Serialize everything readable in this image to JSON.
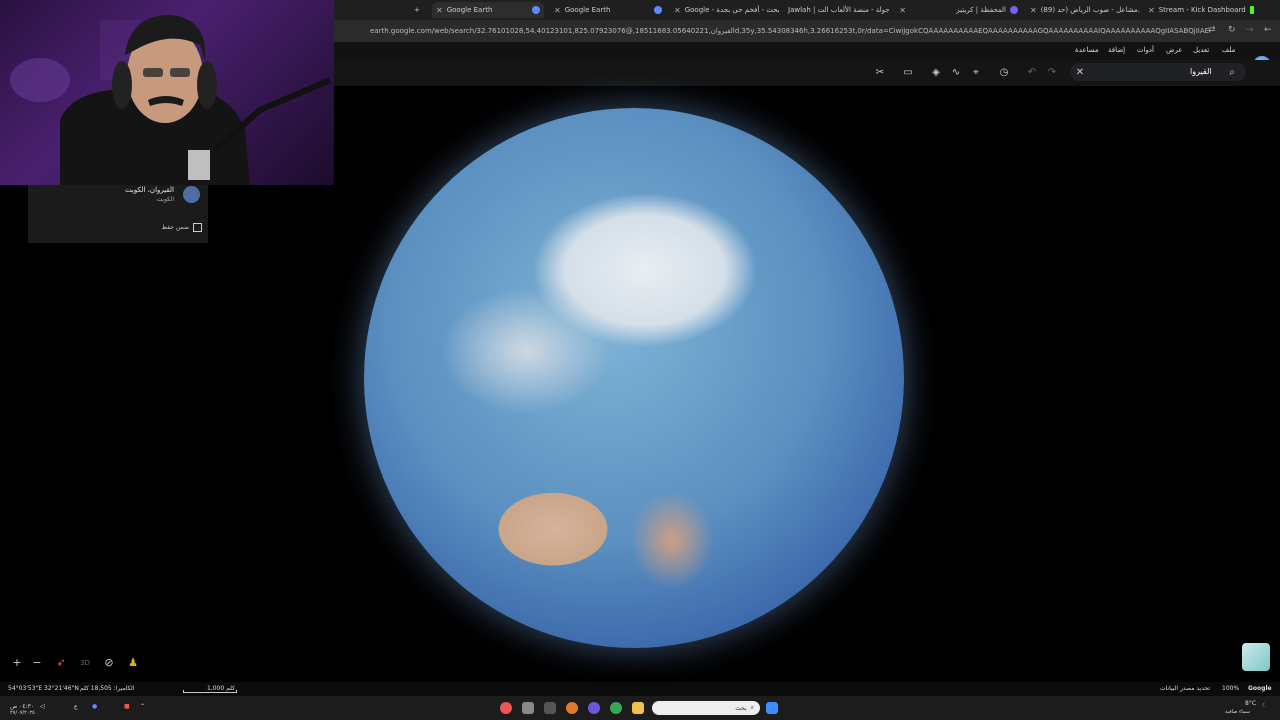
{
  "browser": {
    "tabs": [
      {
        "label": "Google Earth",
        "active": true
      },
      {
        "label": "Google Earth"
      },
      {
        "label": "Google - بحث - أفخم حي بجدة"
      },
      {
        "label": "Jawlah | جولة - منصة الألعاب الت"
      },
      {
        "label": "المحفظة | كريتيز"
      },
      {
        "label": "(89) مشاعل - صوب الرياض (حد..."
      },
      {
        "label": "Stream - Kick Dashboard"
      }
    ],
    "new_tab": "+",
    "url": "earth.google.com/web/search/32.76101028,54.40123101,825.07923076@,القيروان,18511683.05640221d,35y,35.54308346h,3.26616253t,0r/data=CiwiJgokCQAAAAAAAAAAEQAAAAAAAAAAGQAAAAAAAAAAIQAAAAAAAAAAQgIIASABQjIIAEoNCP___________wEQAA"
  },
  "menu": {
    "items": [
      "ملف",
      "تعديل",
      "عرض",
      "أدوات",
      "إضافة",
      "مساعدة"
    ]
  },
  "search": {
    "value": "القيروا"
  },
  "place_card": {
    "title": "القيروان، الكويت",
    "subtitle": "الكويت",
    "save_label": "ضمن حفظ"
  },
  "bottom_controls": {
    "zoom_in": "+",
    "zoom_out": "−",
    "mode_3d": "3D"
  },
  "status": {
    "coords": "54°03'53\"E 32°21'46\"N",
    "camera": "الكاميرا: 18,505 كلم",
    "scale": "1,000 كلم",
    "data_credit": "تحديد مصدر البيانات",
    "zoom": "100%",
    "brand": "Google"
  },
  "taskbar": {
    "search_placeholder": "بحث",
    "weather": "8°C",
    "weather_desc": "سماء صافية",
    "time": "٠٤:٣٠ ص",
    "date": "٢٧/٠٧/٢٠٢٥",
    "lang": "ع"
  }
}
